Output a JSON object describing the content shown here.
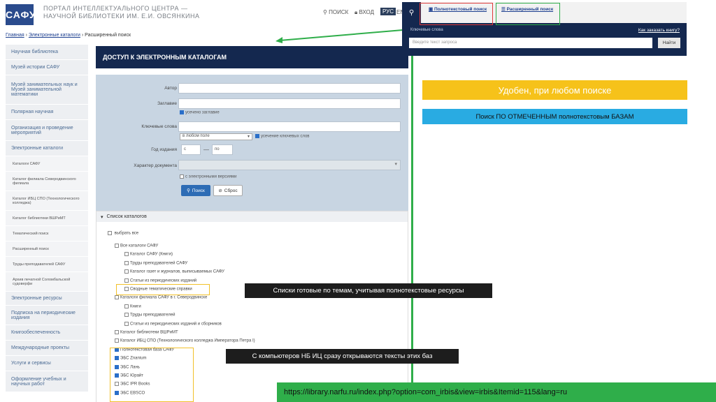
{
  "header": {
    "logo": "САФУ",
    "portal_line1": "ПОРТАЛ ИНТЕЛЛЕКТУАЛЬНОГО ЦЕНТРА —",
    "portal_line2": "НАУЧНОЙ БИБЛИОТЕКИ ИМ. Е.И. ОВСЯНКИНА",
    "search_label": "ПОИСК",
    "login_label": "ВХОД",
    "lang_ru": "РУС",
    "lang_en": "EN"
  },
  "breadcrumb": {
    "home": "Главная",
    "sep1": "›",
    "catalogs": "Электронные каталоги",
    "sep2": "›",
    "current": "Расширенный поиск"
  },
  "sidebar": {
    "items": [
      {
        "label": "Научная библиотека"
      },
      {
        "label": "Музей истории САФУ"
      },
      {
        "label": "Музей занимательных наук и Музей занимательной математики"
      },
      {
        "label": "Полярная научная"
      },
      {
        "label": "Организация и проведение мероприятий"
      },
      {
        "label": "Электронные каталоги"
      },
      {
        "label": "Каталоги САФУ"
      },
      {
        "label": "Каталог филиала Северодвинского филиала"
      },
      {
        "label": "Каталог ИБЦ СПО (Технологического колледжа)"
      },
      {
        "label": "Каталог библиотеки ВШРиМТ"
      },
      {
        "label": "Тематический поиск"
      },
      {
        "label": "Расширенный поиск"
      },
      {
        "label": "Труды преподавателей САФУ"
      },
      {
        "label": "Архив печатной Соломбальской судоверфи"
      },
      {
        "label": "Электронные ресурсы"
      },
      {
        "label": "Подписка на периодические издания"
      },
      {
        "label": "Книгообеспеченность"
      },
      {
        "label": "Международные проекты"
      },
      {
        "label": "Услуги и сервисы"
      },
      {
        "label": "Оформление учебных и научных работ"
      }
    ]
  },
  "main": {
    "title": "ДОСТУП К ЭЛЕКТРОННЫМ КАТАЛОГАМ",
    "form": {
      "author_label": "Автор",
      "title_label": "Заглавие",
      "title_exact": "усечено заглавие",
      "keywords_label": "Ключевые слова",
      "keywords_scope": "в любом поле",
      "keywords_trunc": "усечение ключевых слов",
      "year_label": "Год издания",
      "year_from": "с",
      "year_dash": "—",
      "year_to": "по",
      "doctype_label": "Характер документа",
      "electronic_only": "с электронными версиями",
      "search_button": "Поиск",
      "reset_button": "Сброс"
    },
    "catalog_list": {
      "header": "Список каталогов",
      "select_all": "выбрать все",
      "items": [
        {
          "label": "Все каталоги САФУ",
          "checked": false,
          "indent": 1
        },
        {
          "label": "Каталог САФУ (Книги)",
          "checked": false,
          "indent": 2
        },
        {
          "label": "Труды преподавателей САФУ",
          "checked": false,
          "indent": 2
        },
        {
          "label": "Каталог газет и журналов, выписываемых САФУ",
          "checked": false,
          "indent": 2
        },
        {
          "label": "Статьи из периодических изданий",
          "checked": false,
          "indent": 2
        },
        {
          "label": "Сводные тематические справки",
          "checked": false,
          "indent": 2
        },
        {
          "label": "Каталоги филиала САФУ в г. Северодвинске",
          "checked": false,
          "indent": 1
        },
        {
          "label": "Книги",
          "checked": false,
          "indent": 2
        },
        {
          "label": "Труды преподавателей",
          "checked": false,
          "indent": 2
        },
        {
          "label": "Статьи из периодических изданий и сборников",
          "checked": false,
          "indent": 2
        },
        {
          "label": "Каталог библиотеки ВШРиМТ",
          "checked": false,
          "indent": 1
        },
        {
          "label": "Каталог ИБЦ СПО (Технологического колледжа Императора Петра I)",
          "checked": false,
          "indent": 1
        },
        {
          "label": "Полнотекстовая база САФУ",
          "checked": true,
          "indent": 1
        },
        {
          "label": "ЭБС Znanium",
          "checked": true,
          "indent": 1
        },
        {
          "label": "ЭБС Лань",
          "checked": true,
          "indent": 1
        },
        {
          "label": "ЭБС Юрайт",
          "checked": true,
          "indent": 1
        },
        {
          "label": "ЭБС IPR Books",
          "checked": false,
          "indent": 1
        },
        {
          "label": "ЭБС EBSCO",
          "checked": true,
          "indent": 1
        }
      ]
    }
  },
  "overlay": {
    "tab_fulltext": "Полнотекстовый поиск",
    "tab_extended": "Расширенный поиск",
    "keywords_label": "Ключевые слова",
    "how_to_order": "Как заказать книгу?",
    "query_placeholder": "Введите текст запроса",
    "find_button": "Найти"
  },
  "annotations": {
    "banner_yellow": "Удобен, при любом поиске",
    "banner_blue": "Поиск ПО ОТМЕЧЕННЫМ полнотекстовым БАЗАМ",
    "note_topics": "Списки готовые по темам, учитывая полнотекстовые ресурсы",
    "note_computers": "С компьютеров НБ ИЦ сразу открываются тексты этих баз",
    "url": "https://library.narfu.ru/index.php?option=com_irbis&view=irbis&Itemid=115&lang=ru"
  },
  "colors": {
    "navy": "#14284f",
    "accent_green": "#2fae4a",
    "accent_yellow": "#f6c21a",
    "accent_blue": "#29abe2",
    "highlight_red": "#e03a3a"
  }
}
